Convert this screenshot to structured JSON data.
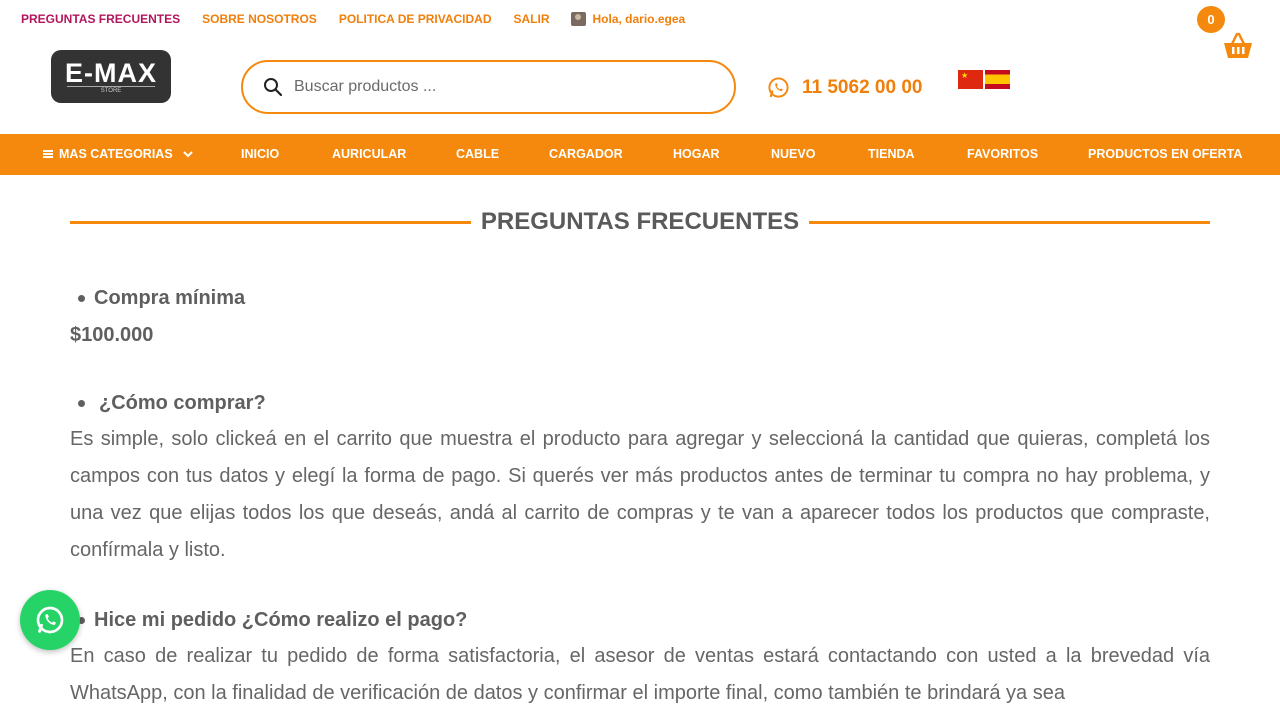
{
  "topbar": {
    "links": [
      "PREGUNTAS FRECUENTES",
      "SOBRE NOSOTROS",
      "POLITICA DE PRIVACIDAD",
      "SALIR"
    ],
    "user_greeting": "Hola, dario.egea",
    "cart_count": "0"
  },
  "header": {
    "logo_text": "E-MAX",
    "logo_sub": "STORE",
    "search_placeholder": "Buscar productos ...",
    "phone": "11 5062 00 00"
  },
  "nav": {
    "categories_label": "MAS CATEGORIAS",
    "items": [
      "INICIO",
      "AURICULAR",
      "CABLE",
      "CARGADOR",
      "HOGAR",
      "NUEVO",
      "TIENDA",
      "FAVORITOS",
      "PRODUCTOS EN OFERTA"
    ]
  },
  "page": {
    "title": "PREGUNTAS FRECUENTES",
    "faq": [
      {
        "question": "Compra mínima",
        "answer": "$100.000"
      },
      {
        "question": "¿Cómo comprar?",
        "answer": "Es simple, solo clickeá en el carrito que muestra el producto para agregar y seleccioná la cantidad que quieras, completá los campos con tus datos y elegí la forma de pago. Si querés ver más productos antes de terminar tu compra no hay problema, y una vez que elijas todos los que deseás, andá al carrito de compras y te van a aparecer todos los productos que compraste, confírmala y listo."
      },
      {
        "question": "Hice mi pedido ¿Cómo realizo el pago?",
        "answer": "En caso de realizar tu pedido de forma satisfactoria, el asesor de ventas estará contactando con usted a la brevedad vía WhatsApp, con la finalidad de verificación de datos y confirmar el importe final, como también te brindará ya sea"
      }
    ]
  },
  "colors": {
    "accent": "#f5890d",
    "active_link": "#b3165d",
    "whatsapp": "#25d366"
  }
}
